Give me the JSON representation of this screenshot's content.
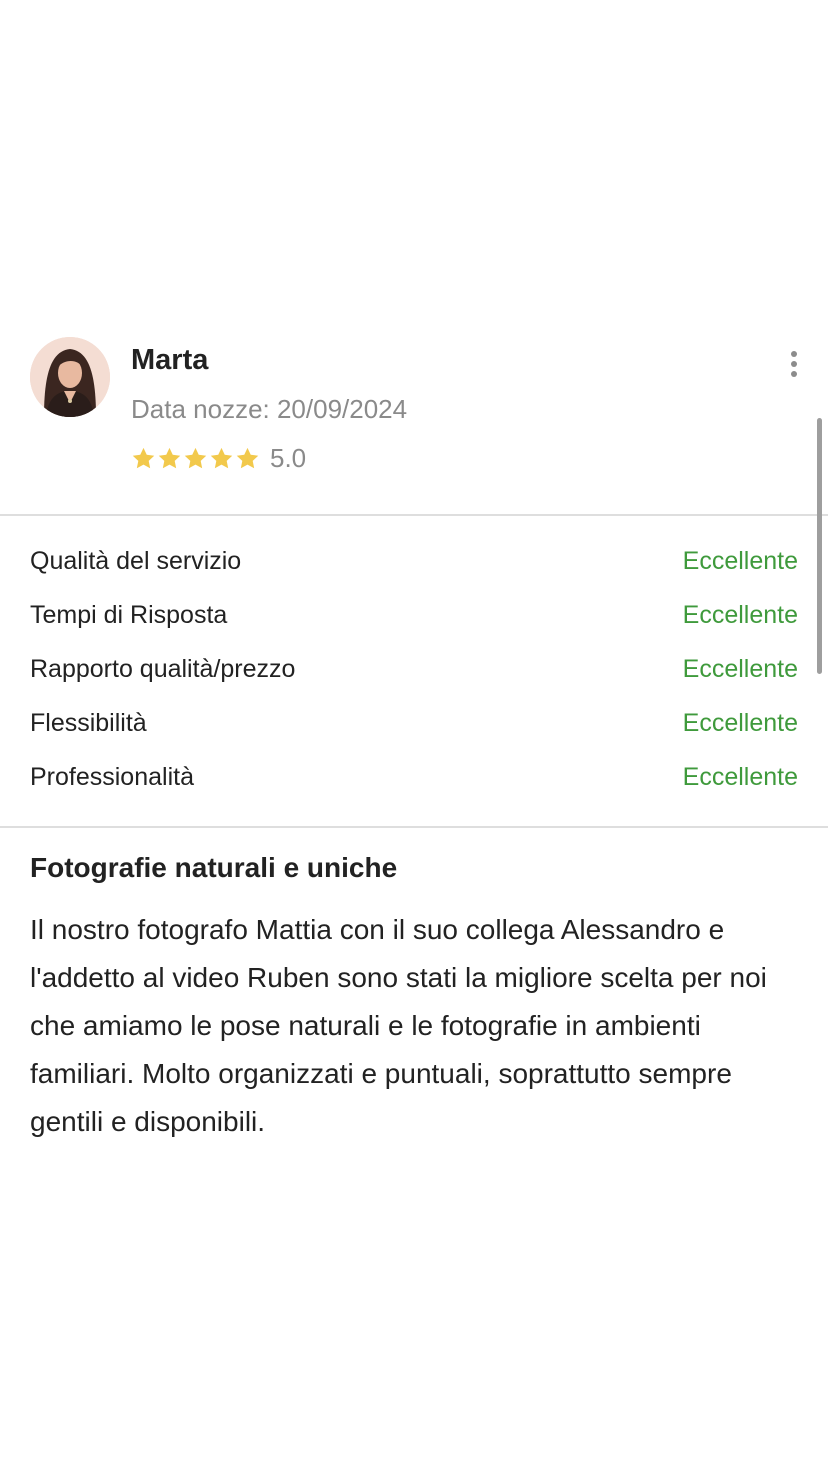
{
  "review": {
    "author": "Marta",
    "wedding_date": "Data nozze: 20/09/2024",
    "rating": {
      "stars": 5,
      "max": 5,
      "value": "5.0"
    },
    "menu_icon": "more-vertical-icon",
    "avatar_icon": "user-photo",
    "criteria": [
      {
        "label": "Qualità del servizio",
        "value": "Eccellente"
      },
      {
        "label": "Tempi di Risposta",
        "value": "Eccellente"
      },
      {
        "label": "Rapporto qualità/prezzo",
        "value": "Eccellente"
      },
      {
        "label": "Flessibilità",
        "value": "Eccellente"
      },
      {
        "label": "Professionalità",
        "value": "Eccellente"
      }
    ],
    "title": "Fotografie naturali e uniche",
    "body": "Il nostro fotografo Mattia con il suo collega Alessandro e l'addetto al video Ruben sono stati la migliore scelta per noi che amiamo le pose naturali e le fotografie in ambienti familiari. Molto organizzati e puntuali, soprattutto sempre gentili e disponibili."
  },
  "colors": {
    "star": "#f2c94c",
    "criterion_value": "#3f9a3c",
    "secondary_text": "#8a8a8a",
    "divider": "#dedede"
  }
}
